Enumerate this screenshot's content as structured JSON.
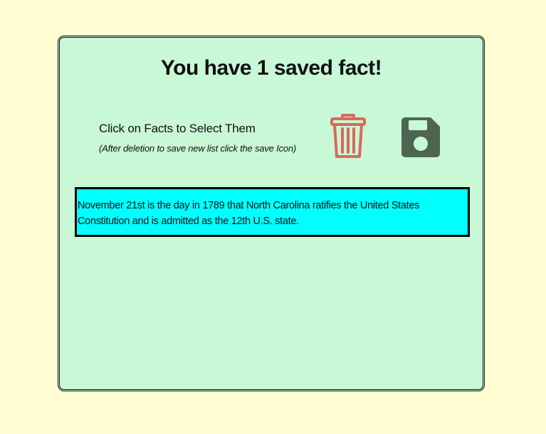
{
  "page": {
    "title": "You have 1 saved fact!",
    "instruction": "Click on Facts to Select Them",
    "instruction_note": "(After deletion to save new list click the save Icon)"
  },
  "toolbar": {
    "delete_icon": "trash-icon",
    "save_icon": "floppy-disk-icon",
    "colors": {
      "delete": "#d9695a",
      "save": "#4e6552"
    }
  },
  "facts": [
    {
      "text": "November 21st is the day in 1789 that North Carolina ratifies the United States Constitution and is admitted as the 12th U.S. state."
    }
  ],
  "colors": {
    "background": "#fffdd2",
    "card": "#c8f8d6",
    "fact_highlight": "#00ffff"
  }
}
